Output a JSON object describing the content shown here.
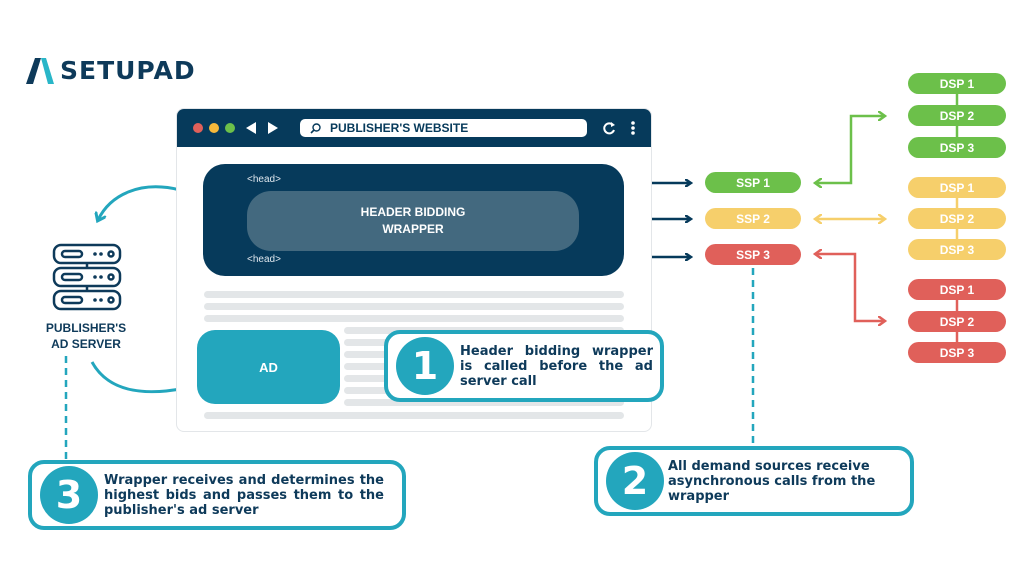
{
  "logo": {
    "text": "SETUPAD",
    "colors": {
      "dark": "#0e3a5a",
      "accent": "#29b6c8"
    }
  },
  "browser": {
    "title": "PUBLISHER'S WEBSITE",
    "icons": [
      "close-dot-icon",
      "minimize-dot-icon",
      "maximize-dot-icon",
      "back-arrow-icon",
      "forward-arrow-icon",
      "search-icon",
      "reload-icon",
      "more-menu-icon"
    ],
    "head_open": "<head>",
    "head_close": "<head>",
    "wrapper_label_line1": "HEADER BIDDING",
    "wrapper_label_line2": "WRAPPER",
    "ad_label": "AD"
  },
  "ad_server": {
    "label_line1": "PUBLISHER'S",
    "label_line2": "AD SERVER"
  },
  "ssps": [
    {
      "label": "SSP 1",
      "color": "#6cc04a"
    },
    {
      "label": "SSP 2",
      "color": "#f6cf6b"
    },
    {
      "label": "SSP 3",
      "color": "#e0605a"
    }
  ],
  "dsp_groups": [
    {
      "color": "#6cc04a",
      "items": [
        "DSP 1",
        "DSP 2",
        "DSP 3"
      ]
    },
    {
      "color": "#f6cf6b",
      "items": [
        "DSP 1",
        "DSP 2",
        "DSP 3"
      ]
    },
    {
      "color": "#e0605a",
      "items": [
        "DSP 1",
        "DSP 2",
        "DSP 3"
      ]
    }
  ],
  "steps": [
    {
      "number": "1",
      "text": "Header bidding wrapper is called before the ad server call"
    },
    {
      "number": "2",
      "text": "All demand sources receive asynchronous calls from the wrapper"
    },
    {
      "number": "3",
      "text": "Wrapper receives and determines the highest bids and passes them to the publisher's ad server"
    }
  ],
  "colors": {
    "navy": "#063a5b",
    "teal": "#23a6bd",
    "wrapper": "#43697f"
  }
}
